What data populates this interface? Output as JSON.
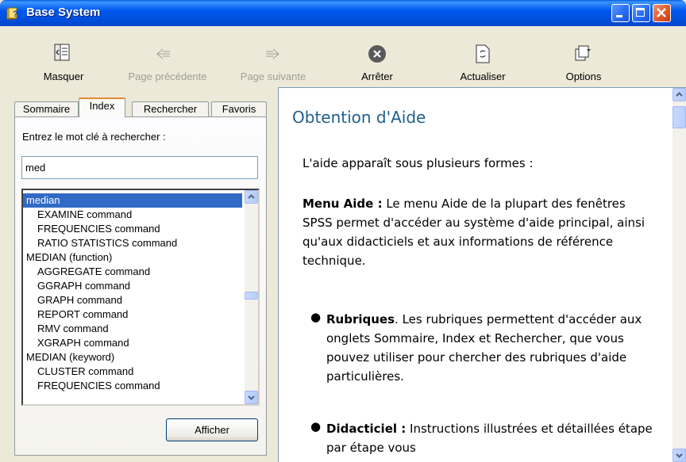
{
  "window": {
    "title": "Base System"
  },
  "toolbar": {
    "hide": "Masquer",
    "back": "Page précédente",
    "forward": "Page suivante",
    "stop": "Arrêter",
    "refresh": "Actualiser",
    "options": "Options"
  },
  "tabs": {
    "contents": "Sommaire",
    "index": "Index",
    "search": "Rechercher",
    "favorites": "Favoris"
  },
  "index_pane": {
    "keyword_label": "Entrez le mot clé à rechercher :",
    "keyword_value": "med",
    "show_button": "Afficher",
    "items": [
      "median",
      "EXAMINE command",
      "FREQUENCIES command",
      "RATIO STATISTICS command",
      "MEDIAN (function)",
      "AGGREGATE command",
      "GGRAPH command",
      "GRAPH command",
      "REPORT command",
      "RMV command",
      "XGRAPH command",
      "MEDIAN (keyword)",
      "CLUSTER command",
      "FREQUENCIES command"
    ]
  },
  "content": {
    "title": "Obtention d'Aide",
    "intro": "L'aide apparaît sous plusieurs formes :",
    "menu_heading": "Menu Aide :",
    "menu_text": "Le menu Aide de la plupart des fenêtres SPSS permet d'accéder au système d'aide principal, ainsi qu'aux didacticiels et aux informations de référence technique.",
    "topics_heading": "Rubriques",
    "topics_text": ". Les rubriques permettent d'accéder aux onglets Sommaire, Index et Rechercher, que vous pouvez utiliser pour chercher des rubriques d'aide particulières.",
    "tutorial_heading": "Didacticiel :",
    "tutorial_text": "Instructions illustrées et détaillées étape par étape vous"
  }
}
